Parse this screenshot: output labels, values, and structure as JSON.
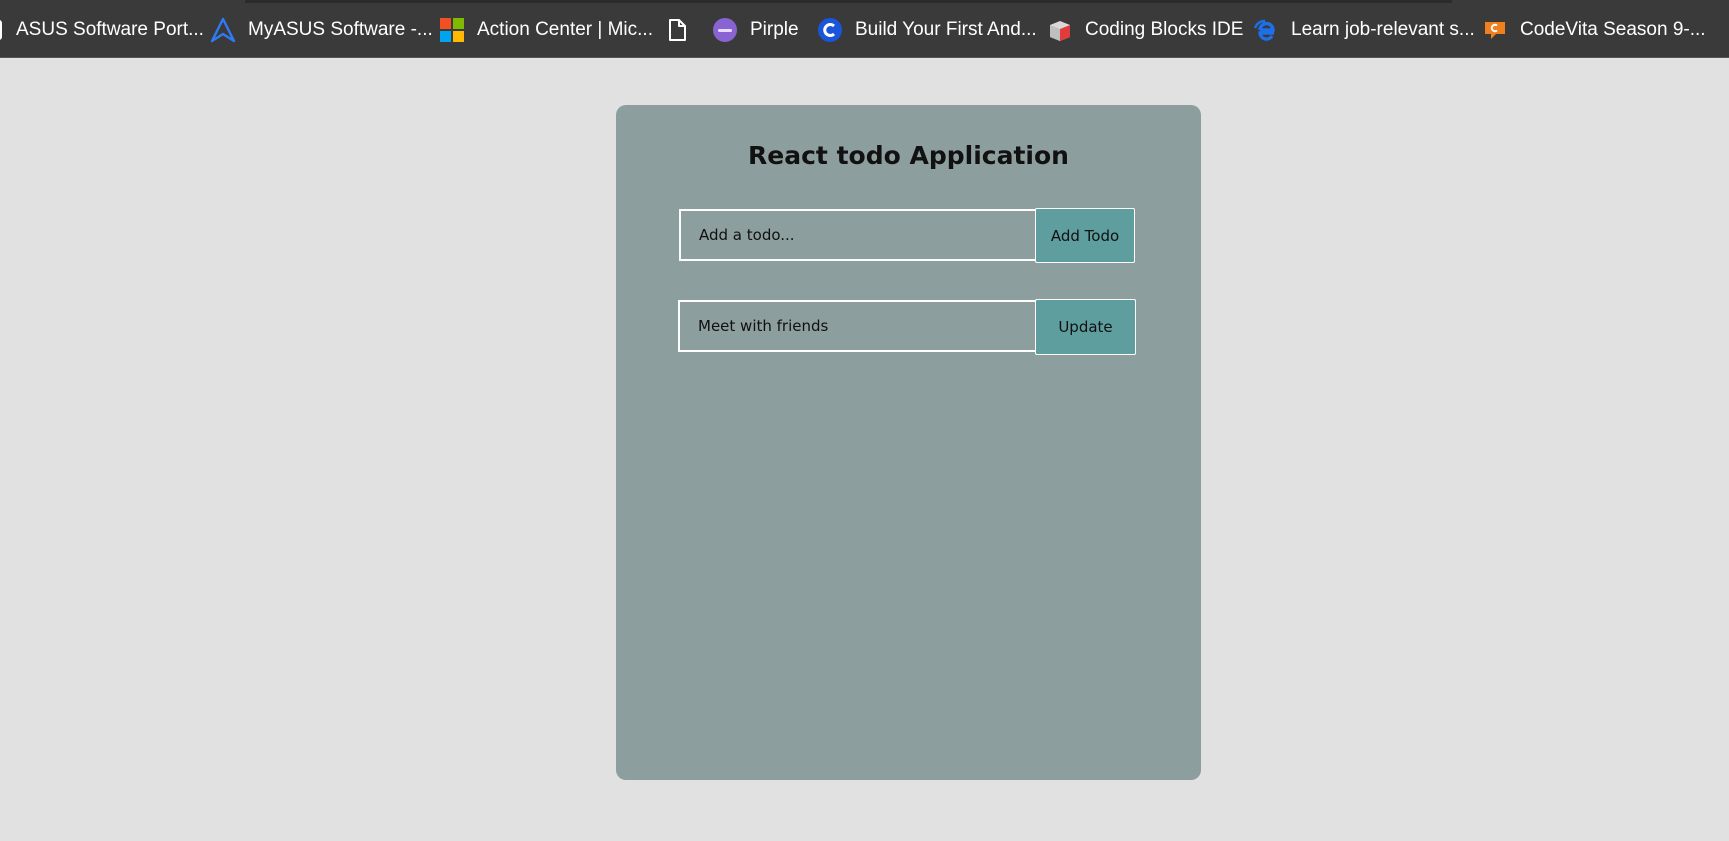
{
  "bookmarks": [
    {
      "label": "ASUS Software Port...",
      "icon": "asus-icon"
    },
    {
      "label": "MyASUS Software -...",
      "icon": "myasus-icon"
    },
    {
      "label": "Action Center | Mic...",
      "icon": "microsoft-icon"
    },
    {
      "label": "",
      "icon": "blank-page-icon"
    },
    {
      "label": "Pirple",
      "icon": "pirple-icon"
    },
    {
      "label": "Build Your First And...",
      "icon": "codeforces-c-icon"
    },
    {
      "label": "Coding Blocks IDE",
      "icon": "coding-blocks-icon"
    },
    {
      "label": "Learn job-relevant s...",
      "icon": "edge-e-icon"
    },
    {
      "label": "CodeVita Season 9-...",
      "icon": "codevita-icon"
    }
  ],
  "app": {
    "title": "React todo Application",
    "add_placeholder": "Add a todo...",
    "add_button": "Add Todo",
    "edit_value": "Meet with friends",
    "update_button": "Update"
  },
  "colors": {
    "page_background": "#e1e1e1",
    "card_background": "#8c9e9d",
    "button_background": "#5e9e9e",
    "bookmarks_bar": "#3a3a3a"
  }
}
